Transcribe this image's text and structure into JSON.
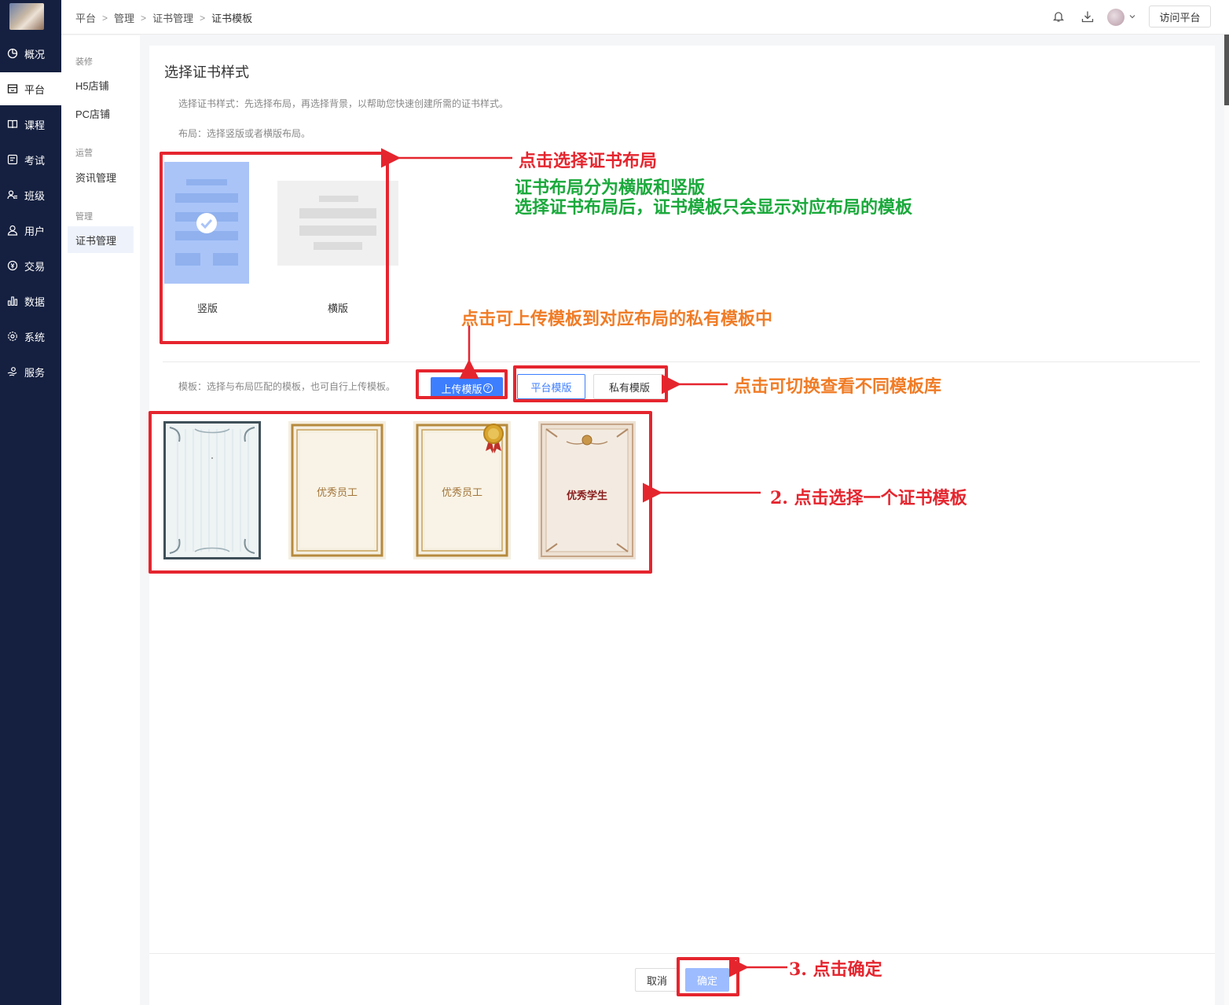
{
  "nav": {
    "items": [
      {
        "label": "概况",
        "icon": "pie-chart-icon"
      },
      {
        "label": "平台",
        "icon": "store-icon"
      },
      {
        "label": "课程",
        "icon": "book-icon"
      },
      {
        "label": "考试",
        "icon": "exam-icon"
      },
      {
        "label": "班级",
        "icon": "group-icon"
      },
      {
        "label": "用户",
        "icon": "user-icon"
      },
      {
        "label": "交易",
        "icon": "currency-icon"
      },
      {
        "label": "数据",
        "icon": "bar-chart-icon"
      },
      {
        "label": "系统",
        "icon": "gear-icon"
      },
      {
        "label": "服务",
        "icon": "service-icon"
      }
    ],
    "active": "平台"
  },
  "breadcrumb": [
    "平台",
    "管理",
    "证书管理",
    "证书模板"
  ],
  "topbar": {
    "visit_label": "访问平台"
  },
  "subnav": {
    "groups": [
      {
        "title": "装修",
        "items": [
          "H5店铺",
          "PC店铺"
        ]
      },
      {
        "title": "运营",
        "items": [
          "资讯管理"
        ]
      },
      {
        "title": "管理",
        "items": [
          "证书管理"
        ]
      }
    ],
    "active": "证书管理"
  },
  "main": {
    "title": "选择证书样式",
    "hint_style": "选择证书样式：先选择布局，再选择背景，以帮助您快速创建所需的证书样式。",
    "hint_layout": "布局：选择竖版或者横版布局。",
    "layouts": [
      {
        "label": "竖版",
        "selected": true
      },
      {
        "label": "横版",
        "selected": false
      }
    ],
    "hint_template": "模板：选择与布局匹配的模板，也可自行上传模板。",
    "upload_label": "上传模版",
    "tabs": [
      {
        "label": "平台模版",
        "active": true
      },
      {
        "label": "私有模版",
        "active": false
      }
    ],
    "templates": [
      {
        "text": "",
        "style": "blue-grey-ornate"
      },
      {
        "text": "优秀员工",
        "style": "gold-frame"
      },
      {
        "text": "优秀员工",
        "style": "gold-frame-medal"
      },
      {
        "text": "优秀学生",
        "style": "bronze-floral"
      }
    ]
  },
  "footer": {
    "cancel_label": "取消",
    "ok_label": "确定"
  },
  "annotations": {
    "layout_title": "点击选择证书布局",
    "layout_desc_1": "证书布局分为横版和竖版",
    "layout_desc_2": "选择证书布局后，证书模板只会显示对应布局的模板",
    "upload_desc": "点击可上传模板到对应布局的私有模板中",
    "switch_desc": "点击可切换查看不同模板库",
    "step2": "2.  点击选择一个证书模板",
    "step3": "3.  点击确定"
  },
  "colors": {
    "nav_bg": "#152040",
    "primary": "#3d7eff",
    "annotation_red": "#e5252e",
    "annotation_green": "#1aa93b",
    "annotation_orange": "#f07c26"
  }
}
